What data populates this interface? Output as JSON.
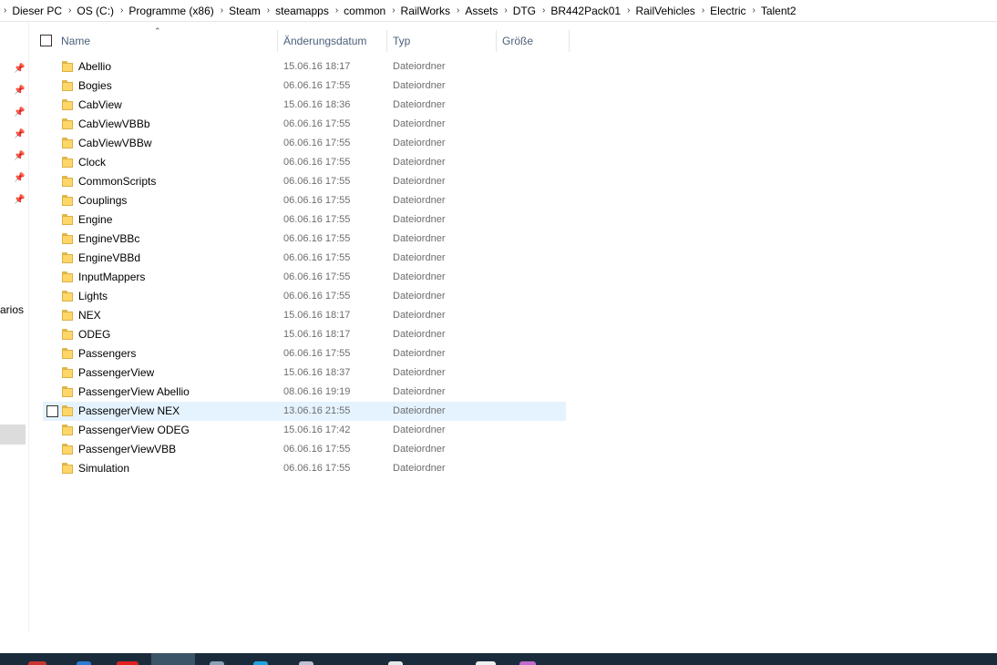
{
  "breadcrumb": [
    "Dieser PC",
    "OS (C:)",
    "Programme (x86)",
    "Steam",
    "steamapps",
    "common",
    "RailWorks",
    "Assets",
    "DTG",
    "BR442Pack01",
    "RailVehicles",
    "Electric",
    "Talent2"
  ],
  "nav": {
    "partial_label": "arios",
    "pin_icon": "pin-icon"
  },
  "columns": {
    "name": "Name",
    "date": "Änderungsdatum",
    "type": "Typ",
    "size": "Größe"
  },
  "files": [
    {
      "name": "Abellio",
      "date": "15.06.16 18:17",
      "type": "Dateiordner"
    },
    {
      "name": "Bogies",
      "date": "06.06.16 17:55",
      "type": "Dateiordner"
    },
    {
      "name": "CabView",
      "date": "15.06.16 18:36",
      "type": "Dateiordner"
    },
    {
      "name": "CabViewVBBb",
      "date": "06.06.16 17:55",
      "type": "Dateiordner"
    },
    {
      "name": "CabViewVBBw",
      "date": "06.06.16 17:55",
      "type": "Dateiordner"
    },
    {
      "name": "Clock",
      "date": "06.06.16 17:55",
      "type": "Dateiordner"
    },
    {
      "name": "CommonScripts",
      "date": "06.06.16 17:55",
      "type": "Dateiordner"
    },
    {
      "name": "Couplings",
      "date": "06.06.16 17:55",
      "type": "Dateiordner"
    },
    {
      "name": "Engine",
      "date": "06.06.16 17:55",
      "type": "Dateiordner"
    },
    {
      "name": "EngineVBBc",
      "date": "06.06.16 17:55",
      "type": "Dateiordner"
    },
    {
      "name": "EngineVBBd",
      "date": "06.06.16 17:55",
      "type": "Dateiordner"
    },
    {
      "name": "InputMappers",
      "date": "06.06.16 17:55",
      "type": "Dateiordner"
    },
    {
      "name": "Lights",
      "date": "06.06.16 17:55",
      "type": "Dateiordner"
    },
    {
      "name": "NEX",
      "date": "15.06.16 18:17",
      "type": "Dateiordner"
    },
    {
      "name": "ODEG",
      "date": "15.06.16 18:17",
      "type": "Dateiordner"
    },
    {
      "name": "Passengers",
      "date": "06.06.16 17:55",
      "type": "Dateiordner"
    },
    {
      "name": "PassengerView",
      "date": "15.06.16 18:37",
      "type": "Dateiordner"
    },
    {
      "name": "PassengerView Abellio",
      "date": "08.06.16 19:19",
      "type": "Dateiordner"
    },
    {
      "name": "PassengerView NEX",
      "date": "13.06.16 21:55",
      "type": "Dateiordner",
      "hover": true
    },
    {
      "name": "PassengerView ODEG",
      "date": "15.06.16 17:42",
      "type": "Dateiordner"
    },
    {
      "name": "PassengerViewVBB",
      "date": "06.06.16 17:55",
      "type": "Dateiordner"
    },
    {
      "name": "Simulation",
      "date": "06.06.16 17:55",
      "type": "Dateiordner"
    }
  ],
  "colors": {
    "hover_row": "#e5f3ff",
    "folder": "#ffd668",
    "header_text": "#4c607a",
    "taskbar": "#1a2c3c"
  }
}
